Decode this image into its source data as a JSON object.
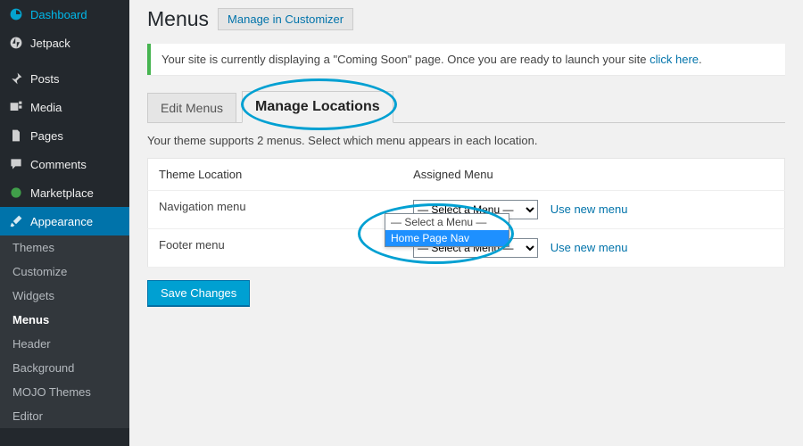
{
  "sidebar": {
    "items": [
      {
        "label": "Dashboard",
        "icon": "dashboard"
      },
      {
        "label": "Jetpack",
        "icon": "jetpack"
      },
      {
        "label": "Posts",
        "icon": "posts"
      },
      {
        "label": "Media",
        "icon": "media"
      },
      {
        "label": "Pages",
        "icon": "pages"
      },
      {
        "label": "Comments",
        "icon": "comments"
      },
      {
        "label": "Marketplace",
        "icon": "marketplace"
      },
      {
        "label": "Appearance",
        "icon": "appearance",
        "current": true
      }
    ],
    "submenu": [
      {
        "label": "Themes"
      },
      {
        "label": "Customize"
      },
      {
        "label": "Widgets"
      },
      {
        "label": "Menus",
        "current": true
      },
      {
        "label": "Header"
      },
      {
        "label": "Background"
      },
      {
        "label": "MOJO Themes"
      },
      {
        "label": "Editor"
      }
    ]
  },
  "page": {
    "title": "Menus",
    "title_action": "Manage in Customizer"
  },
  "notice": {
    "text_before": "Your site is currently displaying a \"Coming Soon\" page. Once you are ready to launch your site ",
    "link_text": "click here",
    "text_after": "."
  },
  "tabs": {
    "edit": "Edit Menus",
    "manage": "Manage Locations"
  },
  "instructions": "Your theme supports 2 menus. Select which menu appears in each location.",
  "table": {
    "head_location": "Theme Location",
    "head_assigned": "Assigned Menu",
    "rows": [
      {
        "location": "Navigation menu",
        "selected": "— Select a Menu —",
        "use_new": "Use new menu"
      },
      {
        "location": "Footer menu",
        "selected": "— Select a Menu —",
        "use_new": "Use new menu"
      }
    ]
  },
  "dropdown_open": {
    "options": [
      "— Select a Menu —",
      "Home Page Nav"
    ],
    "highlight_index": 1
  },
  "save_label": "Save Changes"
}
